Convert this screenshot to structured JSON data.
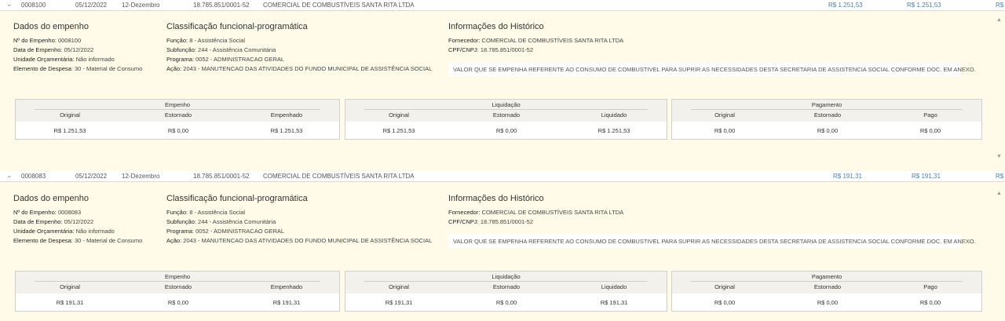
{
  "entries": [
    {
      "row": {
        "chevron": "⌄",
        "numero": "0008100",
        "data": "05/12/2022",
        "mes": "12-Dezembro",
        "cnpj": "18.785.851/0001-52",
        "fornecedor": "COMERCIAL DE COMBUSTÍVEIS SANTA RITA LTDA",
        "valor1": "R$ 1.251,53",
        "valor2": "R$ 1.251,53",
        "valor3": "R$"
      },
      "dados": {
        "title": "Dados do empenho",
        "numero_label": "Nº do Empenho:",
        "numero_value": "0008100",
        "data_label": "Data de Empenho:",
        "data_value": "05/12/2022",
        "unidade_label": "Unidade Orçamentária:",
        "unidade_value": "Não informado",
        "elemento_label": "Elemento de Despesa:",
        "elemento_value": "30 - Material de Consumo"
      },
      "classificacao": {
        "title": "Classificação funcional-programática",
        "funcao_label": "Função:",
        "funcao_value": "8 - Assistência Social",
        "subfuncao_label": "Subfunção:",
        "subfuncao_value": "244 - Assistência Comunitária",
        "programa_label": "Programa:",
        "programa_value": "0052 - ADMINISTRACAO GERAL",
        "acao_label": "Ação:",
        "acao_value": "2043 - MANUTENCAO DAS ATIVIDADES DO FUNDO MUNICIPAL DE ASSISTÊNCIA SOCIAL"
      },
      "historico": {
        "title": "Informações do Histórico",
        "fornecedor_label": "Fornecedor:",
        "fornecedor_value": "COMERCIAL DE COMBUSTÍVEIS SANTA RITA LTDA",
        "cpf_label": "CPF/CNPJ:",
        "cpf_value": "18.785.851/0001-52",
        "texto": "VALOR QUE SE EMPENHA REFERENTE AO CONSUMO DE COMBUSTIVEL PARA SUPRIR AS NECESSIDADES DESTA SECRETARIA DE ASSISTENCIA SOCIAL CONFORME DOC. EM ANEXO."
      },
      "empenho": {
        "title": "Empenho",
        "h1": "Original",
        "h2": "Estornado",
        "h3": "Empenhado",
        "v1": "R$ 1.251,53",
        "v2": "R$ 0,00",
        "v3": "R$ 1.251,53"
      },
      "liquidacao": {
        "title": "Liquidação",
        "h1": "Original",
        "h2": "Estornado",
        "h3": "Liquidado",
        "v1": "R$ 1.251,53",
        "v2": "R$ 0,00",
        "v3": "R$ 1.251,53"
      },
      "pagamento": {
        "title": "Pagamento",
        "h1": "Original",
        "h2": "Estornado",
        "h3": "Pago",
        "v1": "R$ 0,00",
        "v2": "R$ 0,00",
        "v3": "R$ 0,00"
      }
    },
    {
      "row": {
        "chevron": "⌄",
        "numero": "0008083",
        "data": "05/12/2022",
        "mes": "12-Dezembro",
        "cnpj": "18.785.851/0001-52",
        "fornecedor": "COMERCIAL DE COMBUSTÍVEIS SANTA RITA LTDA",
        "valor1": "R$ 191,31",
        "valor2": "R$ 191,31",
        "valor3": "R$"
      },
      "dados": {
        "title": "Dados do empenho",
        "numero_label": "Nº do Empenho:",
        "numero_value": "0008083",
        "data_label": "Data de Empenho:",
        "data_value": "05/12/2022",
        "unidade_label": "Unidade Orçamentária:",
        "unidade_value": "Não informado",
        "elemento_label": "Elemento de Despesa:",
        "elemento_value": "30 - Material de Consumo"
      },
      "classificacao": {
        "title": "Classificação funcional-programática",
        "funcao_label": "Função:",
        "funcao_value": "8 - Assistência Social",
        "subfuncao_label": "Subfunção:",
        "subfuncao_value": "244 - Assistência Comunitária",
        "programa_label": "Programa:",
        "programa_value": "0052 - ADMINISTRACAO GERAL",
        "acao_label": "Ação:",
        "acao_value": "2043 - MANUTENCAO DAS ATIVIDADES DO FUNDO MUNICIPAL DE ASSISTÊNCIA SOCIAL"
      },
      "historico": {
        "title": "Informações do Histórico",
        "fornecedor_label": "Fornecedor:",
        "fornecedor_value": "COMERCIAL DE COMBUSTÍVEIS SANTA RITA LTDA",
        "cpf_label": "CPF/CNPJ:",
        "cpf_value": "18.785.851/0001-52",
        "texto": "VALOR QUE SE EMPENHA REFERENTE AO CONSUMO DE COMBUSTIVEL PARA SUPRIR AS NECESSIDADES DESTA SECRETARIA DE ASSISTENCIA SOCIAL CONFORME DOC. EM ANEXO."
      },
      "empenho": {
        "title": "Empenho",
        "h1": "Original",
        "h2": "Estornado",
        "h3": "Empenhado",
        "v1": "R$ 191,31",
        "v2": "R$ 0,00",
        "v3": "R$ 191,31"
      },
      "liquidacao": {
        "title": "Liquidação",
        "h1": "Original",
        "h2": "Estornado",
        "h3": "Liquidado",
        "v1": "R$ 191,31",
        "v2": "R$ 0,00",
        "v3": "R$ 191,31"
      },
      "pagamento": {
        "title": "Pagamento",
        "h1": "Original",
        "h2": "Estornado",
        "h3": "Pago",
        "v1": "R$ 0,00",
        "v2": "R$ 0,00",
        "v3": "R$ 0,00"
      }
    }
  ],
  "scroll": {
    "up_icon": "▲",
    "down_icon": "▼"
  }
}
